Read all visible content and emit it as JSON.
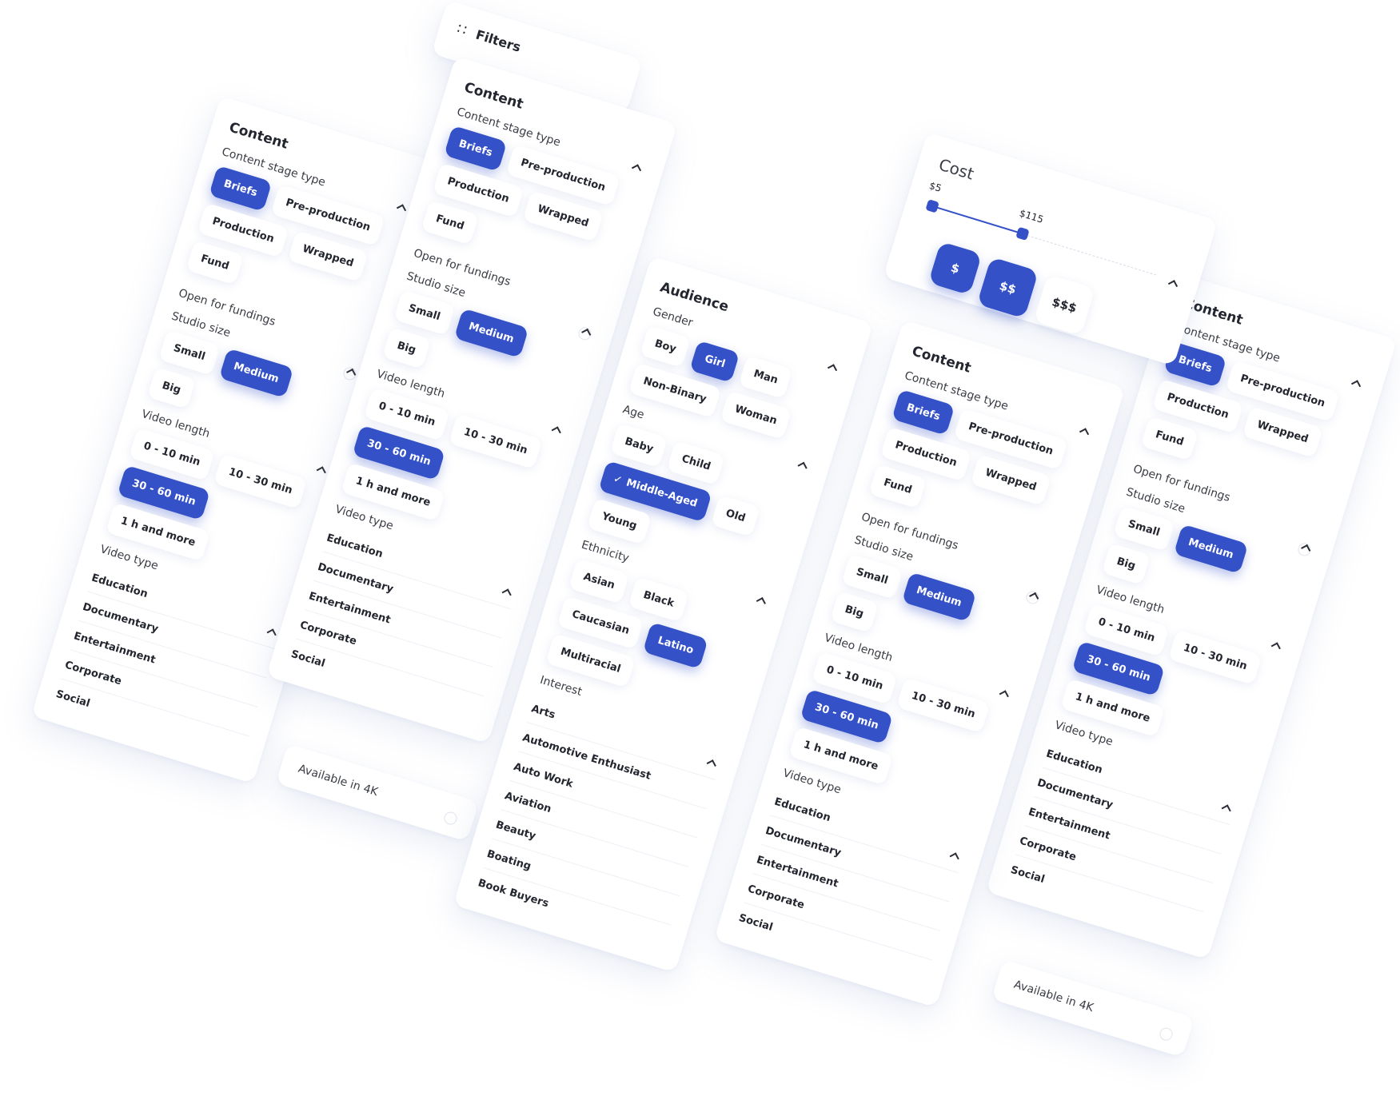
{
  "accent": "#3451c8",
  "filters": {
    "label": "Filters",
    "icon": "sliders-icon"
  },
  "content": {
    "title": "Content",
    "stage_label": "Content stage type",
    "stage_chips": [
      "Briefs",
      "Pre-production",
      "Production",
      "Wrapped",
      "Fund"
    ],
    "stage_selected": "Briefs",
    "open_fundings": "Open for fundings",
    "studio_label": "Studio size",
    "studio_chips": [
      "Small",
      "Medium",
      "Big"
    ],
    "studio_selected": "Medium",
    "length_label": "Video length",
    "length_chips": [
      "0 - 10 min",
      "10 - 30 min",
      "30 - 60 min",
      "1 h and more"
    ],
    "length_selected": "30 - 60 min",
    "type_label": "Video type",
    "type_items": [
      "Education",
      "Documentary",
      "Entertainment",
      "Corporate",
      "Social"
    ]
  },
  "available": {
    "label": "Available in 4K"
  },
  "audience": {
    "title": "Audience",
    "gender_label": "Gender",
    "gender_chips": [
      "Boy",
      "Girl",
      "Man",
      "Non-Binary",
      "Woman"
    ],
    "gender_selected": "Girl",
    "age_label": "Age",
    "age_chips": [
      "Baby",
      "Child",
      "Middle-Aged",
      "Old",
      "Young"
    ],
    "age_selected": "Middle-Aged",
    "ethnicity_label": "Ethnicity",
    "ethnicity_chips": [
      "Asian",
      "Black",
      "Caucasian",
      "Latino",
      "Multiracial"
    ],
    "ethnicity_selected": "Latino",
    "interest_label": "Interest",
    "interest_items": [
      "Arts",
      "Automotive Enthusiast",
      "Auto Work",
      "Aviation",
      "Beauty",
      "Boating",
      "Book Buyers"
    ]
  },
  "cost": {
    "title": "Cost",
    "min_label": "$5",
    "max_label": "$115",
    "range_fraction": 0.4,
    "tiers": [
      "$",
      "$$",
      "$$$"
    ],
    "tiers_selected": [
      "$",
      "$$"
    ]
  }
}
